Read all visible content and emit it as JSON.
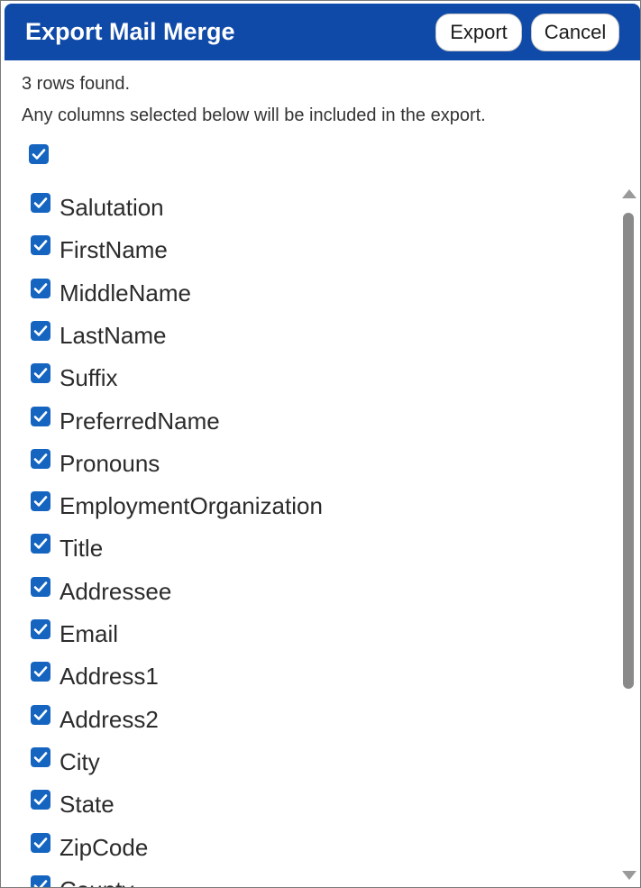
{
  "dialog": {
    "title": "Export Mail Merge",
    "export_label": "Export",
    "cancel_label": "Cancel",
    "rows_found": "3 rows found.",
    "instructions": "Any columns selected below will be included in the export.",
    "select_all_checked": true
  },
  "columns": [
    {
      "label": "Salutation",
      "checked": true
    },
    {
      "label": "FirstName",
      "checked": true
    },
    {
      "label": "MiddleName",
      "checked": true
    },
    {
      "label": "LastName",
      "checked": true
    },
    {
      "label": "Suffix",
      "checked": true
    },
    {
      "label": "PreferredName",
      "checked": true
    },
    {
      "label": "Pronouns",
      "checked": true
    },
    {
      "label": "EmploymentOrganization",
      "checked": true
    },
    {
      "label": "Title",
      "checked": true
    },
    {
      "label": "Addressee",
      "checked": true
    },
    {
      "label": "Email",
      "checked": true
    },
    {
      "label": "Address1",
      "checked": true
    },
    {
      "label": "Address2",
      "checked": true
    },
    {
      "label": "City",
      "checked": true
    },
    {
      "label": "State",
      "checked": true
    },
    {
      "label": "ZipCode",
      "checked": true
    },
    {
      "label": "County",
      "checked": true
    }
  ],
  "colors": {
    "header": "#0f4aa8",
    "checkbox": "#1565c0"
  }
}
